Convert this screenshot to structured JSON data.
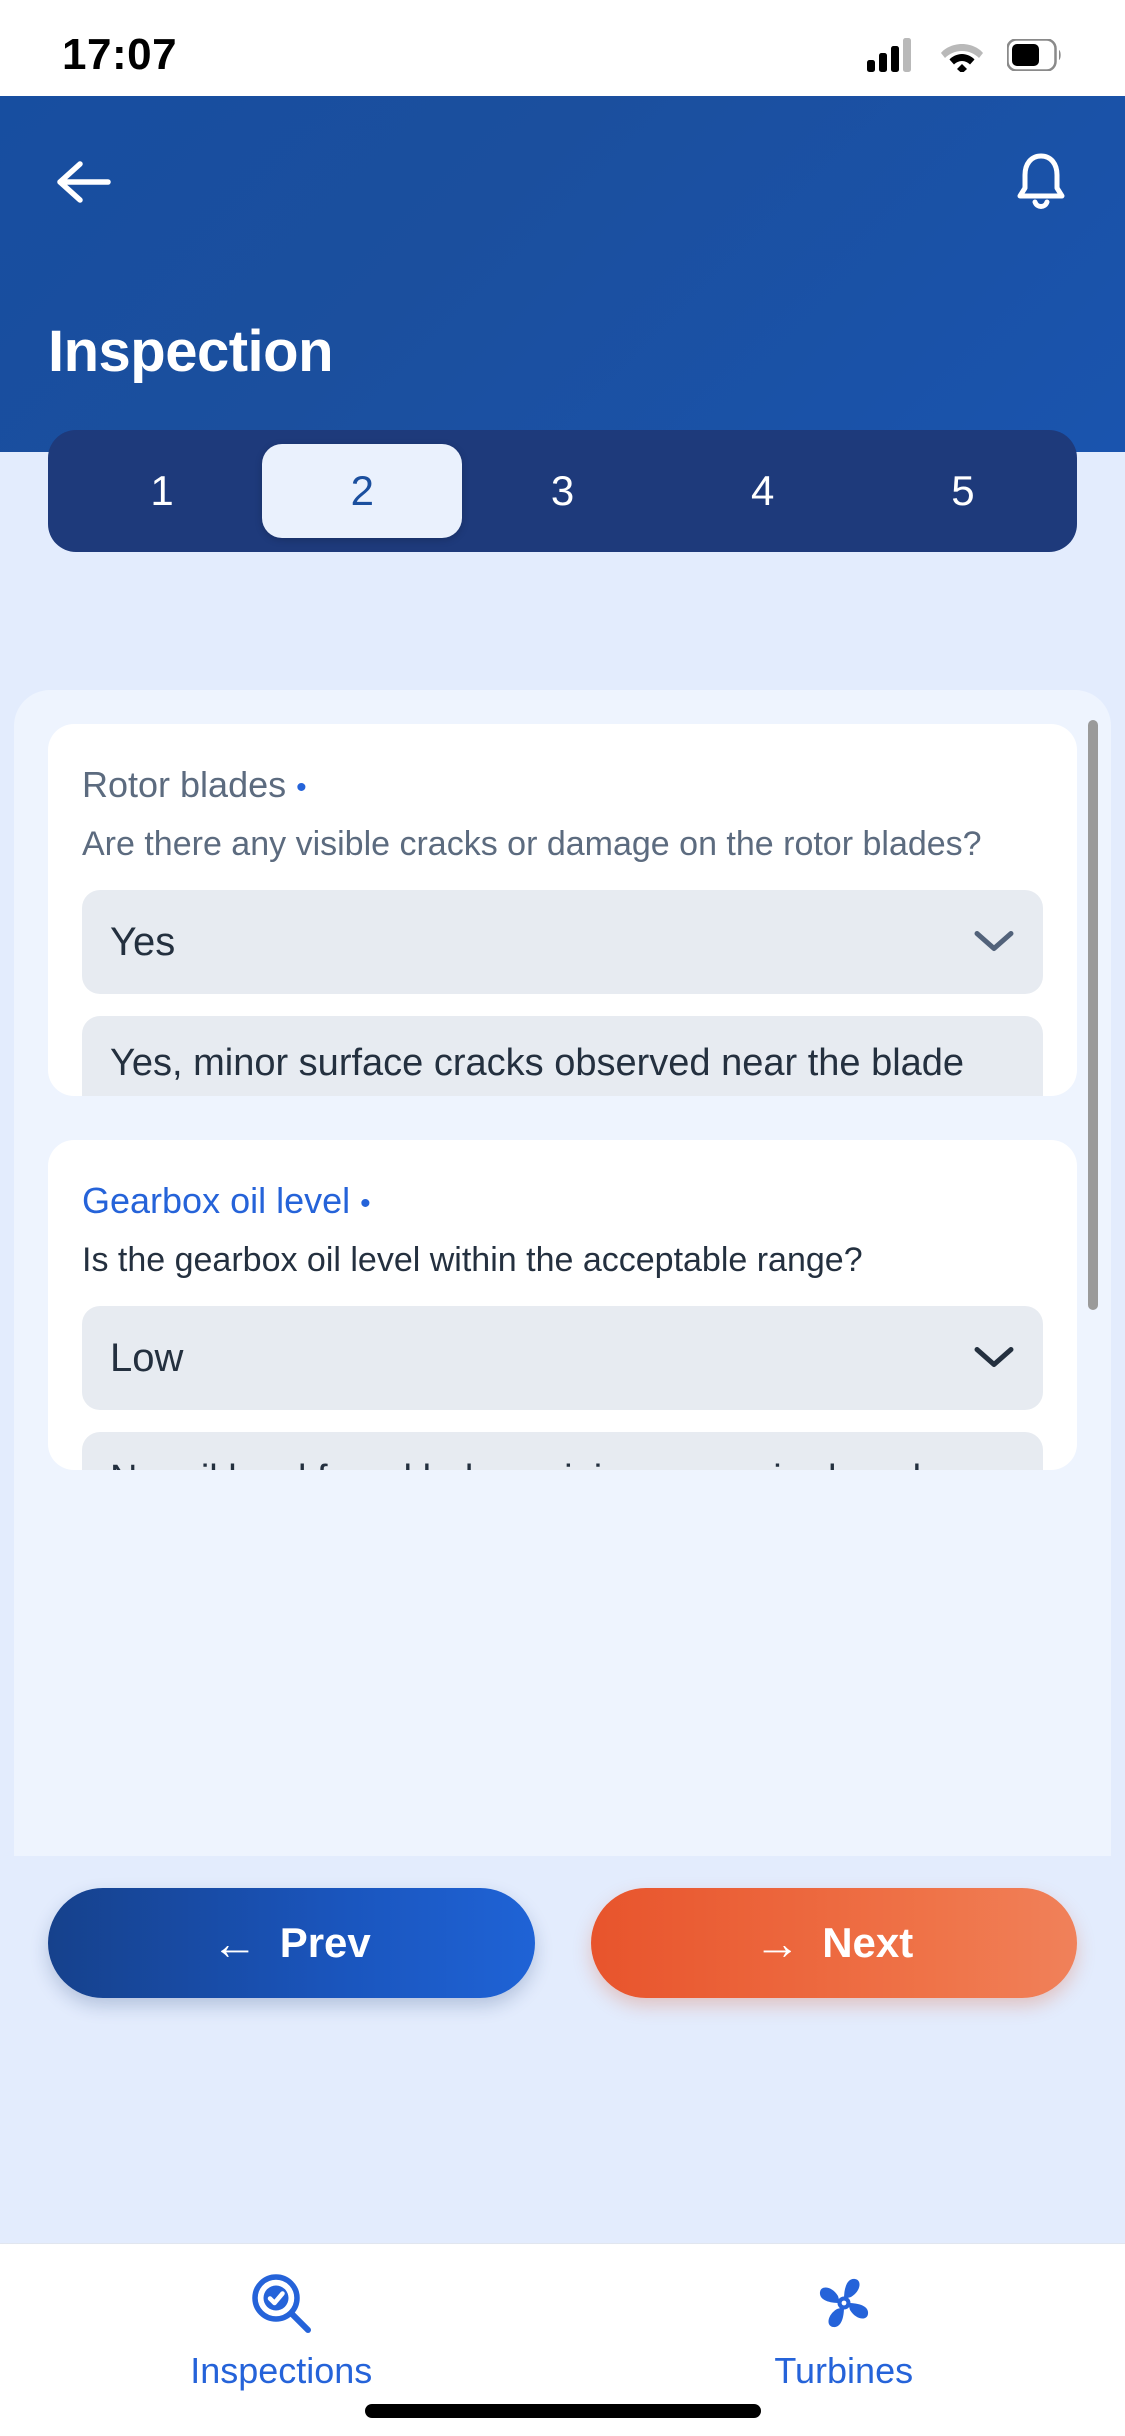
{
  "status_bar": {
    "time": "17:07",
    "icons": [
      "cellular-signal-icon",
      "wifi-icon",
      "battery-icon"
    ]
  },
  "header": {
    "back_icon": "arrow-left-icon",
    "notification_icon": "bell-icon",
    "title": "Inspection",
    "accent_color": "#1b4f9e"
  },
  "steps": {
    "items": [
      {
        "label": "1",
        "active": false
      },
      {
        "label": "2",
        "active": true
      },
      {
        "label": "3",
        "active": false
      },
      {
        "label": "4",
        "active": false
      },
      {
        "label": "5",
        "active": false
      }
    ],
    "active_index": 1
  },
  "cards": [
    {
      "label": "Rotor blades",
      "bullet": "•",
      "question": "Are there any visible cracks or damage on the rotor blades?",
      "select_value": "Yes",
      "chevron_icon": "chevron-down-icon",
      "answer": "Yes, minor surface cracks observed near the blade tip. Further analysis recommended to assess potential"
    },
    {
      "label": "Gearbox oil level",
      "bullet": "•",
      "question": "Is the gearbox oil level within the acceptable range?",
      "select_value": "Low",
      "chevron_icon": "chevron-down-icon",
      "answer": "No, oil level found below minimum required mark. Immediate refill and"
    }
  ],
  "nav": {
    "prev_label": "Prev",
    "prev_icon": "arrow-left-icon",
    "next_label": "Next",
    "next_icon": "arrow-right-icon",
    "prev_color": "#1a55bd",
    "next_color": "#ef7348"
  },
  "tabbar": {
    "items": [
      {
        "label": "Inspections",
        "icon": "magnifier-check-icon",
        "active": true
      },
      {
        "label": "Turbines",
        "icon": "turbine-fan-icon",
        "active": false
      }
    ],
    "active_color": "#2563d9"
  }
}
